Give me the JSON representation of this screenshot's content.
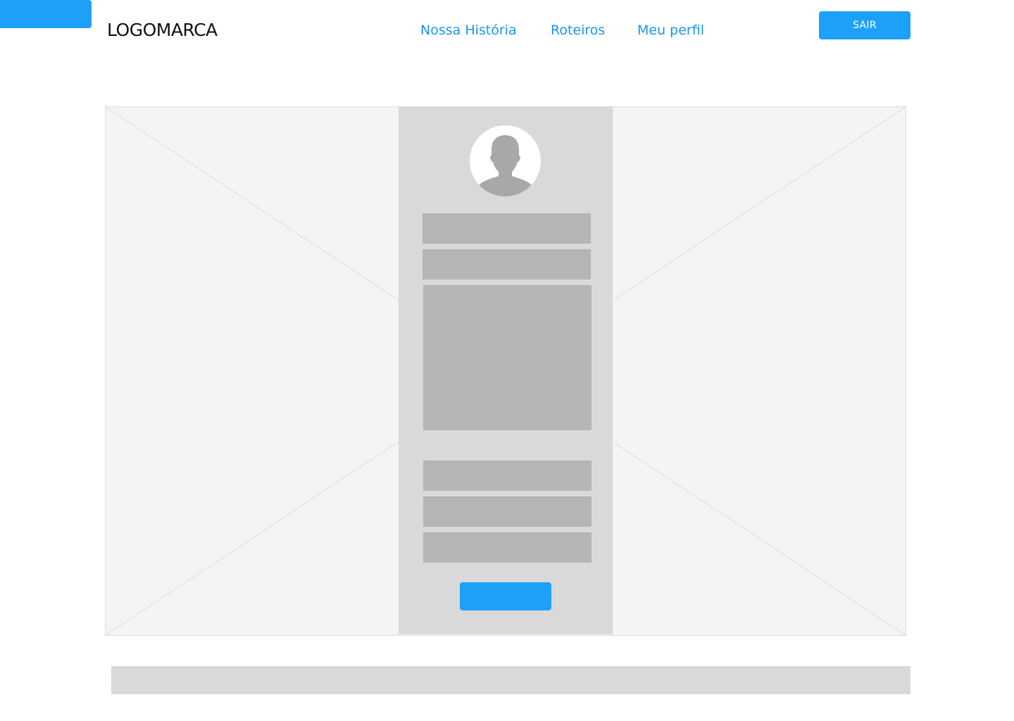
{
  "header": {
    "logo_text": "LOGOMARCA",
    "nav": [
      {
        "label": "Nossa História"
      },
      {
        "label": "Roteiros"
      },
      {
        "label": "Meu perfil"
      }
    ],
    "logout_label": "SAIR"
  },
  "colors": {
    "accent": "#1da1f8",
    "link": "#1a96eb",
    "panel": "#d9d9d9",
    "field": "#b5b5b5",
    "placeholder_bg": "#f4f4f4"
  },
  "icons": {
    "avatar": "user-silhouette-icon",
    "hero": "image-placeholder-icon"
  }
}
